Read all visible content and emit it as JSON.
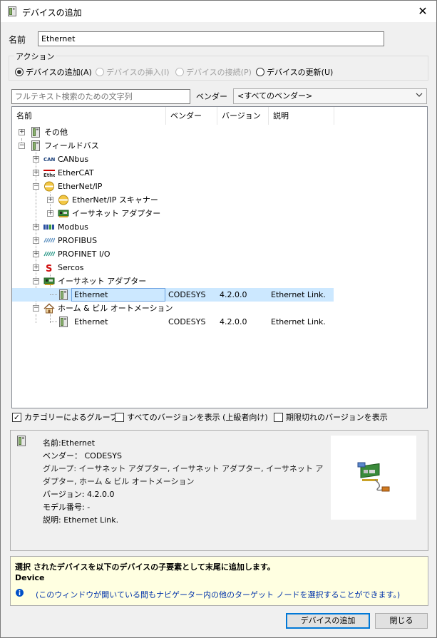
{
  "window": {
    "title": "デバイスの追加",
    "close_glyph": "✕"
  },
  "name_field": {
    "label": "名前",
    "value": "Ethernet"
  },
  "action": {
    "label": "アクション",
    "options": [
      {
        "label": "デバイスの追加(A)",
        "selected": true,
        "enabled": true
      },
      {
        "label": "デバイスの挿入(I)",
        "selected": false,
        "enabled": false
      },
      {
        "label": "デバイスの接続(P)",
        "selected": false,
        "enabled": false
      },
      {
        "label": "デバイスの更新(U)",
        "selected": false,
        "enabled": true
      }
    ]
  },
  "search": {
    "placeholder": "フルテキスト検索のための文字列",
    "value": ""
  },
  "vendor": {
    "label": "ベンダー",
    "selected": "<すべてのベンダー>"
  },
  "tree": {
    "columns": [
      "名前",
      "ベンダー",
      "バージョン",
      "説明"
    ],
    "rows": [
      {
        "label": "その他",
        "icon": "device-folder-icon",
        "expander": "+"
      },
      {
        "label": "フィールドバス",
        "icon": "device-folder-icon",
        "expander": "−"
      },
      {
        "label": "CANbus",
        "icon": "canbus-icon",
        "expander": "+"
      },
      {
        "label": "EtherCAT",
        "icon": "ethercat-icon",
        "expander": "+"
      },
      {
        "label": "EtherNet/IP",
        "icon": "ethernetip-icon",
        "expander": "−"
      },
      {
        "label": "EtherNet/IP スキャナー",
        "icon": "ethernetip-icon",
        "expander": "+"
      },
      {
        "label": "イーサネット アダプター",
        "icon": "network-card-icon",
        "expander": "+"
      },
      {
        "label": "Modbus",
        "icon": "modbus-icon",
        "expander": "+"
      },
      {
        "label": "PROFIBUS",
        "icon": "profibus-icon",
        "expander": "+"
      },
      {
        "label": "PROFINET I/O",
        "icon": "profinet-icon",
        "expander": "+"
      },
      {
        "label": "Sercos",
        "icon": "sercos-icon",
        "expander": "+"
      },
      {
        "label": "イーサネット アダプター",
        "icon": "network-card-icon",
        "expander": "−"
      },
      {
        "label": "Ethernet",
        "icon": "device-icon",
        "vendor": "CODESYS",
        "version": "4.2.0.0",
        "description": "Ethernet Link.",
        "selected": true
      },
      {
        "label": "ホーム & ビル オートメーション",
        "icon": "home-icon",
        "expander": "−"
      },
      {
        "label": "Ethernet",
        "icon": "device-icon",
        "vendor": "CODESYS",
        "version": "4.2.0.0",
        "description": "Ethernet Link."
      }
    ]
  },
  "options": {
    "group_by_category": {
      "label": "カテゴリーによるグループ",
      "checked": true
    },
    "show_all_versions": {
      "label": "すべてのバージョンを表示 (上級者向け)",
      "checked": false
    },
    "show_outdated": {
      "label": "期限切れのバージョンを表示",
      "checked": false
    }
  },
  "info": {
    "name": "名前:Ethernet",
    "vendor": "ベンダー： CODESYS",
    "group_line1": "グループ: イーサネット アダプター, イーサネット アダプター, イーサネット ア",
    "group_line2": "ダプター, ホーム & ビル オートメーション",
    "version": "バージョン: 4.2.0.0",
    "model": "モデル番号: -",
    "description": "説明: Ethernet Link."
  },
  "hint": {
    "line1": "選択 されたデバイスを以下のデバイスの子要素として末尾に追加します。",
    "line2": "Device",
    "note": "(このウィンドウが開いている間もナビゲーター内の他のターゲット ノードを選択することができます。)"
  },
  "buttons": {
    "add": "デバイスの追加",
    "close": "閉じる"
  },
  "colors": {
    "selection": "#cce8ff",
    "hint_bg": "#ffffe1",
    "info_icon": "#0050c8",
    "link_text": "#0033aa"
  }
}
